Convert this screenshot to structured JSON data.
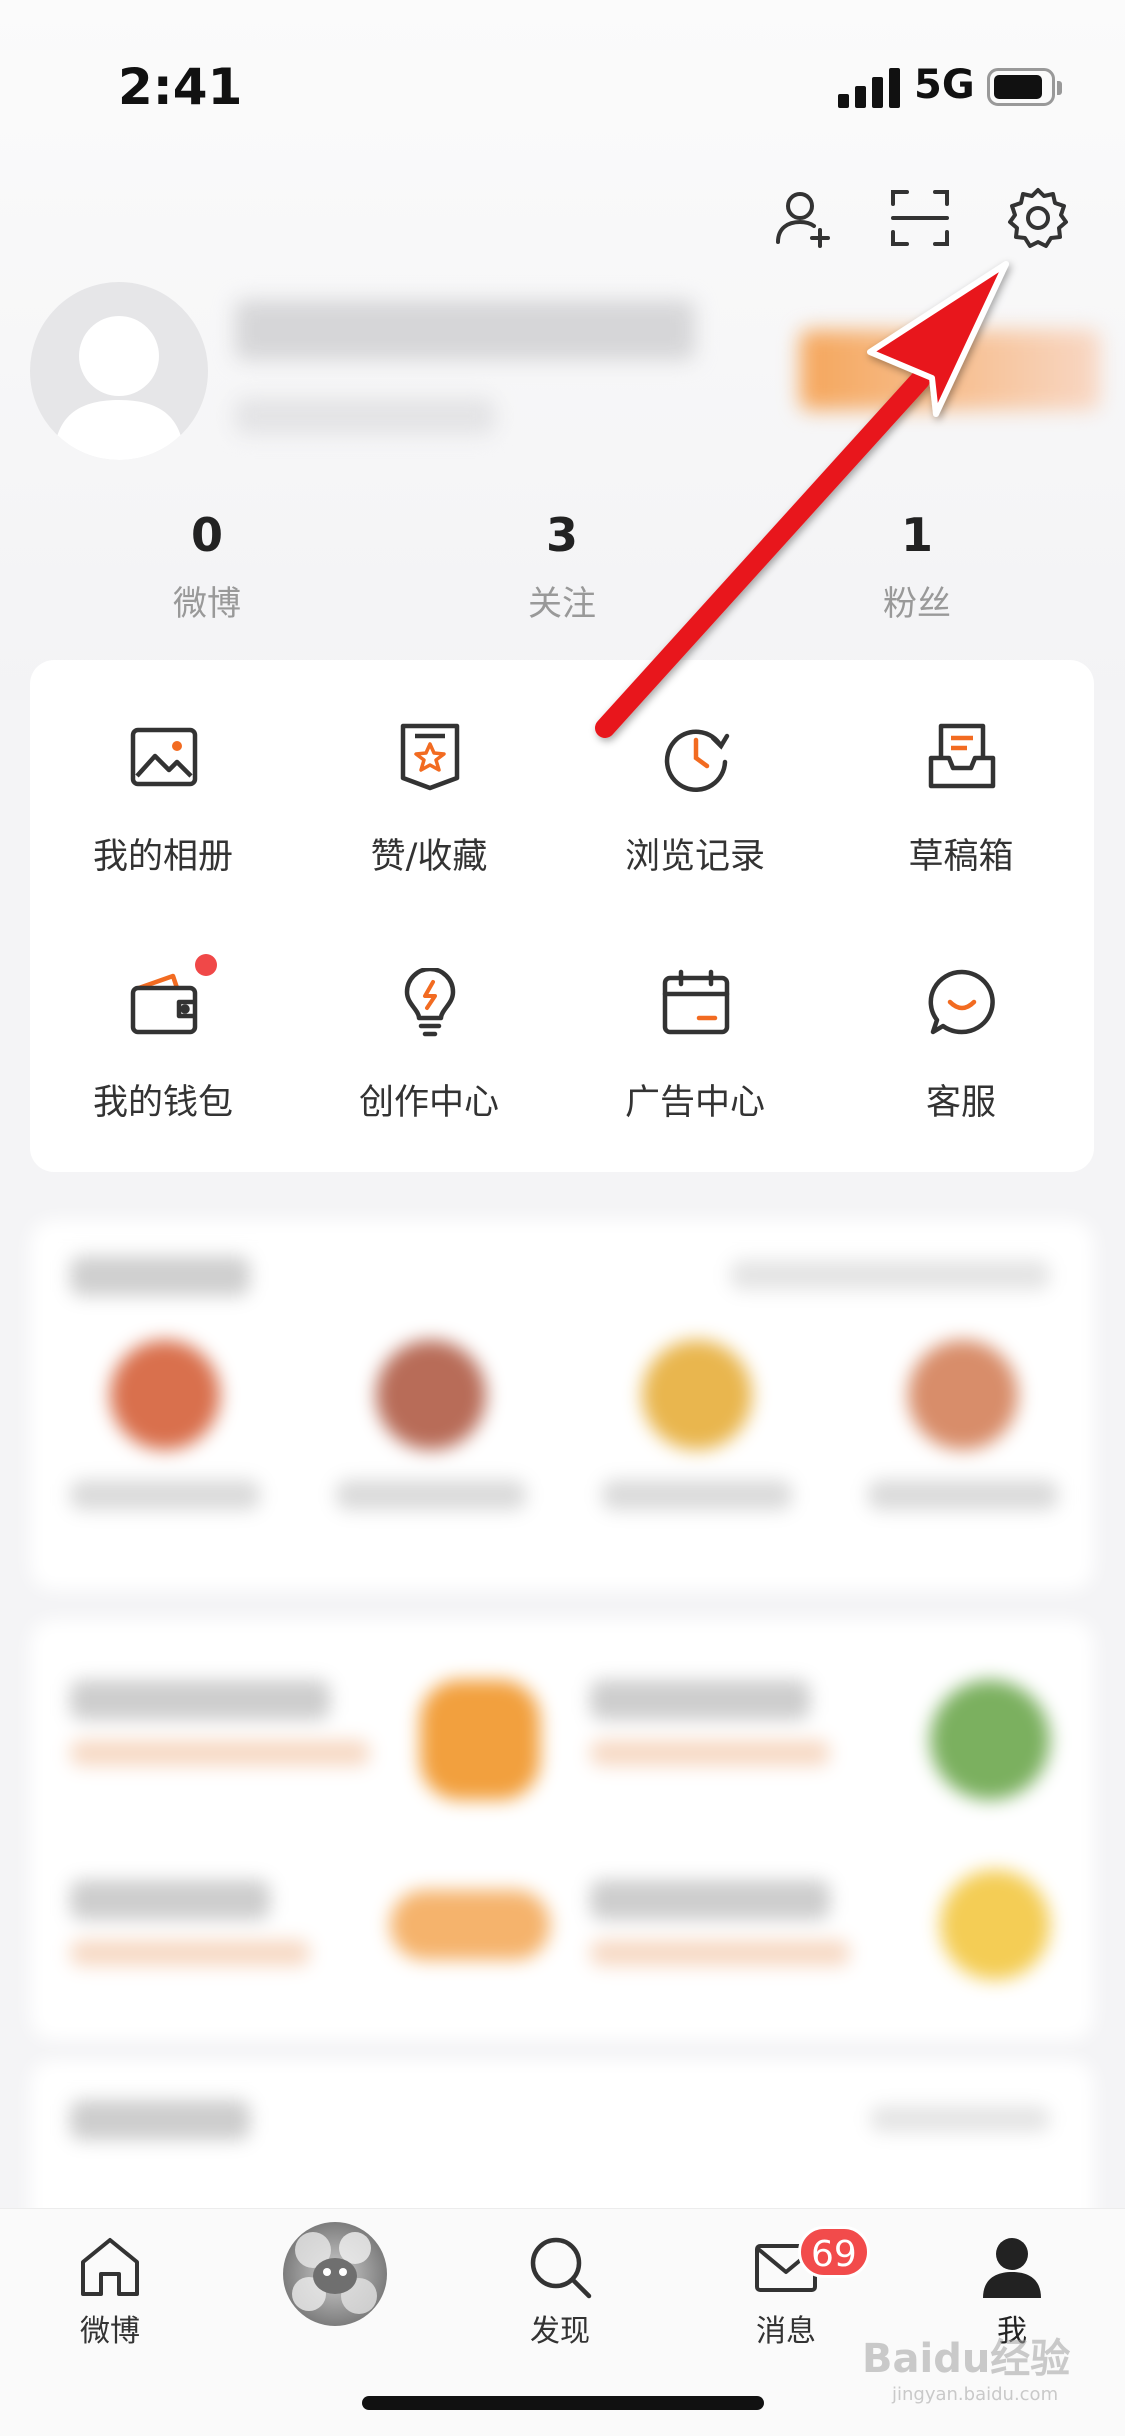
{
  "status_bar": {
    "time": "2:41",
    "network": "5G"
  },
  "header": {
    "icons": [
      "add-friend-icon",
      "scan-icon",
      "settings-icon"
    ]
  },
  "stats": [
    {
      "value": "0",
      "label": "微博"
    },
    {
      "value": "3",
      "label": "关注"
    },
    {
      "value": "1",
      "label": "粉丝"
    }
  ],
  "menu": [
    {
      "label": "我的相册",
      "icon": "album-icon"
    },
    {
      "label": "赞/收藏",
      "icon": "favorites-icon"
    },
    {
      "label": "浏览记录",
      "icon": "history-icon"
    },
    {
      "label": "草稿箱",
      "icon": "drafts-icon"
    },
    {
      "label": "我的钱包",
      "icon": "wallet-icon",
      "notification_dot": true
    },
    {
      "label": "创作中心",
      "icon": "creator-bulb-icon"
    },
    {
      "label": "广告中心",
      "icon": "ad-calendar-icon"
    },
    {
      "label": "客服",
      "icon": "customer-service-icon"
    }
  ],
  "tab_bar": {
    "tabs": [
      {
        "label": "微博",
        "icon": "home-icon"
      },
      {
        "label": "",
        "icon": "center-avatar"
      },
      {
        "label": "发现",
        "icon": "search-icon"
      },
      {
        "label": "消息",
        "icon": "mail-icon",
        "badge": "69"
      },
      {
        "label": "我",
        "icon": "person-icon",
        "active": true
      }
    ]
  },
  "watermark": {
    "text": "Baidu经验",
    "sub": "jingyan.baidu.com"
  },
  "colors": {
    "accent": "#f26b21",
    "badge": "#f24b4b",
    "annotation_arrow": "#e8161b"
  }
}
